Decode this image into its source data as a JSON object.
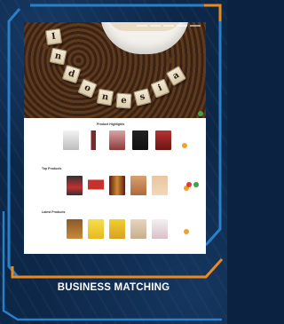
{
  "caption": "BUSINESS MATCHING",
  "hero": {
    "tiles": [
      "I",
      "n",
      "d",
      "o",
      "n",
      "e",
      "s",
      "i",
      "a"
    ]
  },
  "sections": [
    {
      "title": "Product Highlights",
      "link": "",
      "products": [
        "",
        "",
        "",
        "",
        ""
      ]
    },
    {
      "title": "Top Products",
      "link": "",
      "products": [
        "",
        "",
        "",
        "",
        "",
        ""
      ]
    },
    {
      "title": "Latest Products",
      "link": "",
      "products": [
        "",
        "",
        "",
        "",
        "",
        ""
      ]
    }
  ],
  "colors": {
    "frame_blue": "#2a7fc9",
    "frame_orange": "#e88a1c",
    "arrow": "#f0a030",
    "chat_red": "#e53935",
    "chat_green": "#43a047"
  }
}
